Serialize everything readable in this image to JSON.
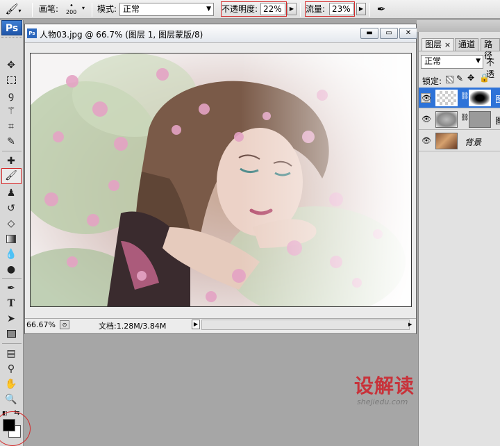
{
  "options_bar": {
    "brush_label": "画笔:",
    "brush_size": "200",
    "mode_label": "模式:",
    "mode_value": "正常",
    "opacity_label": "不透明度:",
    "opacity_value": "22%",
    "flow_label": "流量:",
    "flow_value": "23%"
  },
  "toolbox": {
    "logo": "Ps",
    "type_tool": "T"
  },
  "document": {
    "title": "人物03.jpg @ 66.7% (图层 1, 图层蒙版/8)",
    "ps_icon": "Ps",
    "zoom": "66.67%",
    "doc_info": "文档:1.28M/3.84M"
  },
  "layers_panel": {
    "tabs": [
      "图层",
      "通道",
      "路径"
    ],
    "tab_close": "×",
    "blend_mode": "正常",
    "opacity_label": "不透",
    "lock_label": "锁定:",
    "layers": [
      {
        "name": "图",
        "selected": true
      },
      {
        "name": "图",
        "selected": false
      },
      {
        "name": "背景",
        "selected": false
      }
    ]
  },
  "watermark": {
    "brand": "设解读",
    "url": "shejiedu.com"
  },
  "colors": {
    "accent_red": "#d42a2a",
    "selected_layer": "#2e73d8",
    "watermark_red": "#c8323a"
  }
}
